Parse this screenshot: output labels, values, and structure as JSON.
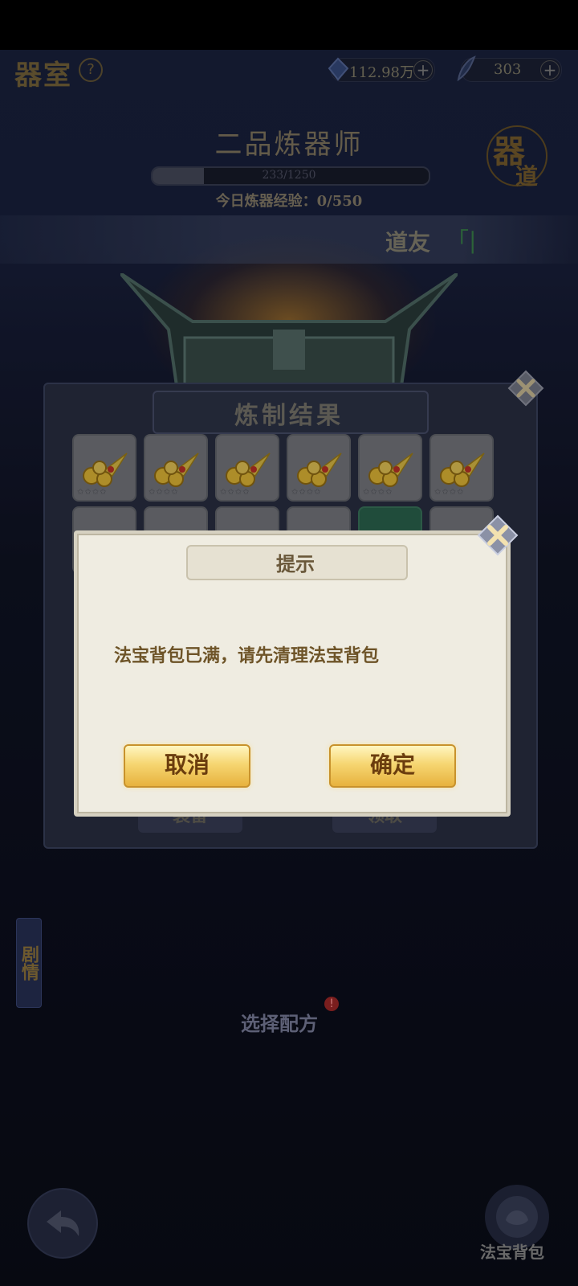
{
  "header": {
    "title": "器室",
    "help_symbol": "?",
    "currency1_value": "112.98万",
    "currency2_value": "303",
    "plus": "+"
  },
  "rank": {
    "title": "二品炼器师",
    "exp_progress_text": "233/1250",
    "exp_fraction": 0.186,
    "today_exp": "今日炼器经验：0/550",
    "badge_chars": [
      "器",
      "道"
    ]
  },
  "daoyou": {
    "text": "道友",
    "quote": "「|"
  },
  "result_panel": {
    "title": "炼制结果",
    "row1_slots": [
      {
        "item": "gold-coins-item",
        "quality": "grey"
      },
      {
        "item": "gold-coins-item",
        "quality": "grey"
      },
      {
        "item": "gold-coins-item",
        "quality": "grey"
      },
      {
        "item": "gold-coins-item",
        "quality": "grey"
      },
      {
        "item": "gold-coins-item",
        "quality": "grey"
      },
      {
        "item": "gold-coins-item",
        "quality": "grey"
      }
    ],
    "stars": "✩✩✩✩",
    "row2_slots": [
      {
        "quality": "grey"
      },
      {
        "quality": "grey"
      },
      {
        "quality": "grey"
      },
      {
        "quality": "grey"
      },
      {
        "quality": "green"
      },
      {
        "quality": "grey"
      }
    ],
    "left_button": "装备",
    "right_button": "领取"
  },
  "dialog": {
    "title": "提示",
    "message": "法宝背包已满，请先清理法宝背包",
    "cancel_label": "取消",
    "confirm_label": "确定"
  },
  "bottom": {
    "side_tab": "剧情",
    "select_recipe": "选择配方",
    "recipe_badge": "!",
    "bag_label": "法宝背包"
  },
  "colors": {
    "gold_button": "#f6d672",
    "dialog_bg": "#efece1",
    "panel_bg": "#2b3146"
  }
}
